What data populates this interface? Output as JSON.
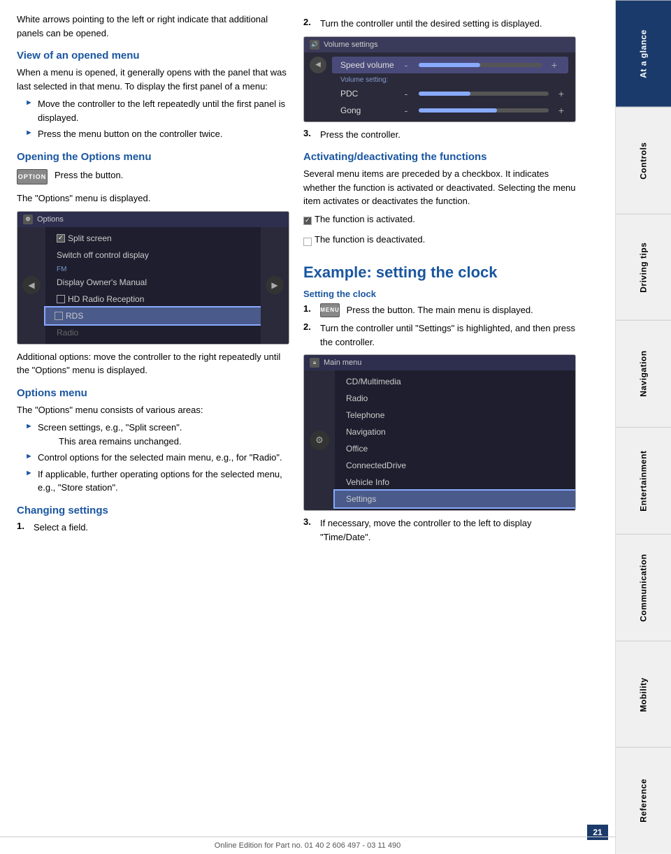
{
  "sidebar": {
    "tabs": [
      {
        "label": "At a glance",
        "active": true
      },
      {
        "label": "Controls",
        "active": false
      },
      {
        "label": "Driving tips",
        "active": false
      },
      {
        "label": "Navigation",
        "active": false
      },
      {
        "label": "Entertainment",
        "active": false
      },
      {
        "label": "Communication",
        "active": false
      },
      {
        "label": "Mobility",
        "active": false
      },
      {
        "label": "Reference",
        "active": false
      }
    ]
  },
  "content": {
    "intro_text": "White arrows pointing to the left or right indicate that additional panels can be opened.",
    "section1": {
      "heading": "View of an opened menu",
      "body": "When a menu is opened, it generally opens with the panel that was last selected in that menu. To display the first panel of a menu:",
      "bullets": [
        "Move the controller to the left repeatedly until the first panel is displayed.",
        "Press the menu button on the controller twice."
      ]
    },
    "section2": {
      "heading": "Opening the Options menu",
      "option_btn_label": "OPTION",
      "press_text": "Press the button.",
      "display_text": "The \"Options\" menu is displayed.",
      "options_screen": {
        "title": "Options",
        "title_icon": "⚙",
        "items": [
          {
            "label": "Split screen",
            "type": "checked",
            "highlighted": false
          },
          {
            "label": "Switch off control display",
            "type": "normal",
            "highlighted": false
          },
          {
            "label": "FM",
            "type": "section",
            "highlighted": false
          },
          {
            "label": "Display Owner's Manual",
            "type": "normal",
            "highlighted": false
          },
          {
            "label": "HD Radio Reception",
            "type": "checkbox",
            "highlighted": false
          },
          {
            "label": "RDS",
            "type": "checkbox",
            "highlighted": true
          },
          {
            "label": "Radio",
            "type": "dimmed",
            "highlighted": false
          }
        ]
      },
      "additional_text": "Additional options: move the controller to the right repeatedly until the \"Options\" menu is displayed."
    },
    "section3": {
      "heading": "Options menu",
      "body": "The \"Options\" menu consists of various areas:",
      "bullets": [
        {
          "main": "Screen settings, e.g., \"Split screen\".",
          "sub": "This area remains unchanged."
        },
        {
          "main": "Control options for the selected main menu, e.g., for \"Radio\".",
          "sub": null
        },
        {
          "main": "If applicable, further operating options for the selected menu, e.g., \"Store station\".",
          "sub": null
        }
      ]
    },
    "section4": {
      "heading": "Changing settings",
      "steps": [
        {
          "num": "1.",
          "text": "Select a field."
        }
      ]
    }
  },
  "right_content": {
    "step2": {
      "num": "2.",
      "text": "Turn the controller until the desired setting is displayed."
    },
    "vol_screen": {
      "title": "Volume settings",
      "title_icon": "🔊",
      "active_row": "Speed volume",
      "rows": [
        {
          "label": "Speed volume",
          "value": 50,
          "active": true
        },
        {
          "label": "Volume setting:",
          "type": "header"
        },
        {
          "label": "PDC",
          "value": 40,
          "active": false
        },
        {
          "label": "Gong",
          "value": 60,
          "active": false
        }
      ]
    },
    "step3": {
      "num": "3.",
      "text": "Press the controller."
    },
    "section_activating": {
      "heading": "Activating/deactivating the functions",
      "body": "Several menu items are preceded by a checkbox. It indicates whether the function is activated or deactivated. Selecting the menu item activates or deactivates the function.",
      "activated_text": "The function is activated.",
      "deactivated_text": "The function is deactivated."
    },
    "big_heading": "Example: setting the clock",
    "section_setting": {
      "heading": "Setting the clock",
      "step1": {
        "num": "1.",
        "menu_btn": "MENU",
        "text": "Press the button. The main menu is displayed."
      },
      "step2": {
        "num": "2.",
        "text": "Turn the controller until \"Settings\" is highlighted, and then press the controller."
      },
      "main_menu_screen": {
        "title": "Main menu",
        "title_icon": "≡",
        "items": [
          {
            "label": "CD/Multimedia",
            "highlighted": false
          },
          {
            "label": "Radio",
            "highlighted": false
          },
          {
            "label": "Telephone",
            "highlighted": false
          },
          {
            "label": "Navigation",
            "highlighted": false
          },
          {
            "label": "Office",
            "highlighted": false
          },
          {
            "label": "ConnectedDrive",
            "highlighted": false
          },
          {
            "label": "Vehicle Info",
            "highlighted": false
          },
          {
            "label": "Settings",
            "highlighted": true
          }
        ]
      },
      "step3": {
        "num": "3.",
        "text": "If necessary, move the controller to the left to display \"Time/Date\"."
      }
    }
  },
  "footer": {
    "text": "Online Edition for Part no. 01 40 2 606 497 - 03 11 490",
    "page_number": "21"
  }
}
